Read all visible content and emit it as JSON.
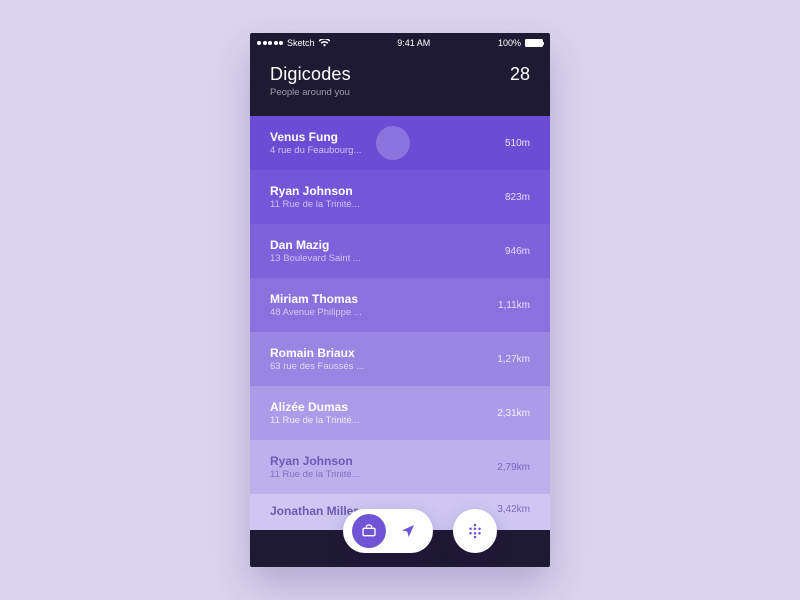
{
  "status": {
    "carrier": "Sketch",
    "time": "9:41 AM",
    "battery": "100%"
  },
  "header": {
    "title": "Digicodes",
    "subtitle": "People around you",
    "count": "28"
  },
  "rows": [
    {
      "name": "Venus Fung",
      "addr": "4 rue du Feaubourg...",
      "dist": "510m",
      "bg": "#6a4dd4",
      "name_c": "#ffffff",
      "addr_c": "rgba(255,255,255,0.65)",
      "dist_c": "rgba(255,255,255,0.85)"
    },
    {
      "name": "Ryan Johnson",
      "addr": "11 Rue de la Trinité...",
      "dist": "823m",
      "bg": "#7357d8",
      "name_c": "#ffffff",
      "addr_c": "rgba(255,255,255,0.62)",
      "dist_c": "rgba(255,255,255,0.80)"
    },
    {
      "name": "Dan Mazig",
      "addr": "13 Boulevard Saint ...",
      "dist": "946m",
      "bg": "#7d63db",
      "name_c": "#ffffff",
      "addr_c": "rgba(255,255,255,0.60)",
      "dist_c": "rgba(255,255,255,0.78)"
    },
    {
      "name": "Miriam Thomas",
      "addr": "48 Avenue Philippe ...",
      "dist": "1,11km",
      "bg": "#8a72de",
      "name_c": "#ffffff",
      "addr_c": "rgba(255,255,255,0.60)",
      "dist_c": "rgba(255,255,255,0.78)"
    },
    {
      "name": "Romain Briaux",
      "addr": "63 rue des Faussés ...",
      "dist": "1,27km",
      "bg": "#9985e2",
      "name_c": "#ffffff",
      "addr_c": "rgba(255,255,255,0.68)",
      "dist_c": "rgba(255,255,255,0.78)"
    },
    {
      "name": "Alizée Dumas",
      "addr": "11 Rue de la Trinité...",
      "dist": "2,31km",
      "bg": "#ab9be8",
      "name_c": "#ffffff",
      "addr_c": "rgba(255,255,255,0.78)",
      "dist_c": "rgba(255,255,255,0.85)"
    },
    {
      "name": "Ryan Johnson",
      "addr": "11 Rue de la Trinité...",
      "dist": "2,79km",
      "bg": "#bdb1ed",
      "name_c": "#6d59b8",
      "addr_c": "rgba(109,89,184,0.75)",
      "dist_c": "rgba(109,89,184,0.85)"
    },
    {
      "name": "Jonathan Miller",
      "addr": "",
      "dist": "3,42km",
      "bg": "#cfc7f2",
      "name_c": "#6d59b8",
      "addr_c": "rgba(109,89,184,0.7)",
      "dist_c": "rgba(109,89,184,0.85)"
    }
  ]
}
